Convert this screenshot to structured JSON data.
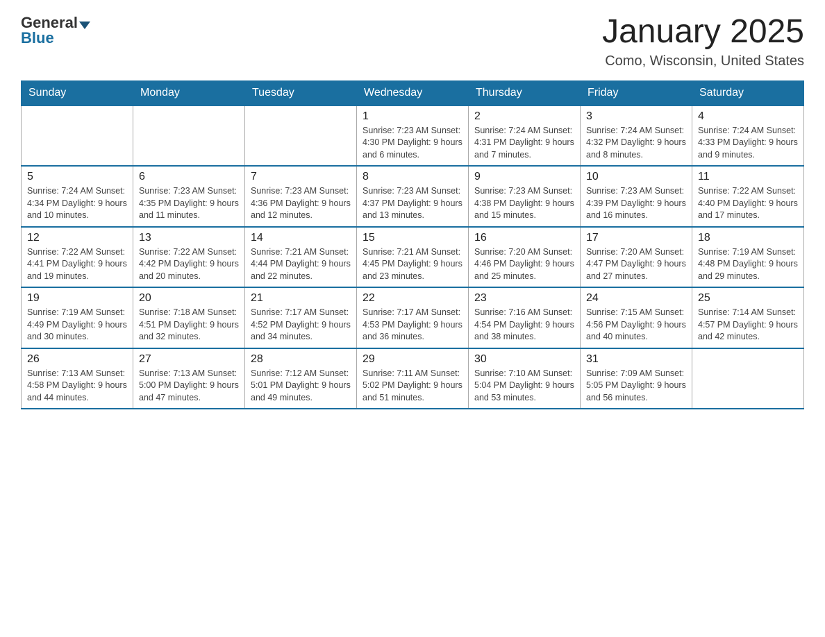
{
  "header": {
    "logo_general": "General",
    "logo_blue": "Blue",
    "title": "January 2025",
    "subtitle": "Como, Wisconsin, United States"
  },
  "calendar": {
    "days_of_week": [
      "Sunday",
      "Monday",
      "Tuesday",
      "Wednesday",
      "Thursday",
      "Friday",
      "Saturday"
    ],
    "weeks": [
      [
        {
          "day": "",
          "info": ""
        },
        {
          "day": "",
          "info": ""
        },
        {
          "day": "",
          "info": ""
        },
        {
          "day": "1",
          "info": "Sunrise: 7:23 AM\nSunset: 4:30 PM\nDaylight: 9 hours and 6 minutes."
        },
        {
          "day": "2",
          "info": "Sunrise: 7:24 AM\nSunset: 4:31 PM\nDaylight: 9 hours and 7 minutes."
        },
        {
          "day": "3",
          "info": "Sunrise: 7:24 AM\nSunset: 4:32 PM\nDaylight: 9 hours and 8 minutes."
        },
        {
          "day": "4",
          "info": "Sunrise: 7:24 AM\nSunset: 4:33 PM\nDaylight: 9 hours and 9 minutes."
        }
      ],
      [
        {
          "day": "5",
          "info": "Sunrise: 7:24 AM\nSunset: 4:34 PM\nDaylight: 9 hours and 10 minutes."
        },
        {
          "day": "6",
          "info": "Sunrise: 7:23 AM\nSunset: 4:35 PM\nDaylight: 9 hours and 11 minutes."
        },
        {
          "day": "7",
          "info": "Sunrise: 7:23 AM\nSunset: 4:36 PM\nDaylight: 9 hours and 12 minutes."
        },
        {
          "day": "8",
          "info": "Sunrise: 7:23 AM\nSunset: 4:37 PM\nDaylight: 9 hours and 13 minutes."
        },
        {
          "day": "9",
          "info": "Sunrise: 7:23 AM\nSunset: 4:38 PM\nDaylight: 9 hours and 15 minutes."
        },
        {
          "day": "10",
          "info": "Sunrise: 7:23 AM\nSunset: 4:39 PM\nDaylight: 9 hours and 16 minutes."
        },
        {
          "day": "11",
          "info": "Sunrise: 7:22 AM\nSunset: 4:40 PM\nDaylight: 9 hours and 17 minutes."
        }
      ],
      [
        {
          "day": "12",
          "info": "Sunrise: 7:22 AM\nSunset: 4:41 PM\nDaylight: 9 hours and 19 minutes."
        },
        {
          "day": "13",
          "info": "Sunrise: 7:22 AM\nSunset: 4:42 PM\nDaylight: 9 hours and 20 minutes."
        },
        {
          "day": "14",
          "info": "Sunrise: 7:21 AM\nSunset: 4:44 PM\nDaylight: 9 hours and 22 minutes."
        },
        {
          "day": "15",
          "info": "Sunrise: 7:21 AM\nSunset: 4:45 PM\nDaylight: 9 hours and 23 minutes."
        },
        {
          "day": "16",
          "info": "Sunrise: 7:20 AM\nSunset: 4:46 PM\nDaylight: 9 hours and 25 minutes."
        },
        {
          "day": "17",
          "info": "Sunrise: 7:20 AM\nSunset: 4:47 PM\nDaylight: 9 hours and 27 minutes."
        },
        {
          "day": "18",
          "info": "Sunrise: 7:19 AM\nSunset: 4:48 PM\nDaylight: 9 hours and 29 minutes."
        }
      ],
      [
        {
          "day": "19",
          "info": "Sunrise: 7:19 AM\nSunset: 4:49 PM\nDaylight: 9 hours and 30 minutes."
        },
        {
          "day": "20",
          "info": "Sunrise: 7:18 AM\nSunset: 4:51 PM\nDaylight: 9 hours and 32 minutes."
        },
        {
          "day": "21",
          "info": "Sunrise: 7:17 AM\nSunset: 4:52 PM\nDaylight: 9 hours and 34 minutes."
        },
        {
          "day": "22",
          "info": "Sunrise: 7:17 AM\nSunset: 4:53 PM\nDaylight: 9 hours and 36 minutes."
        },
        {
          "day": "23",
          "info": "Sunrise: 7:16 AM\nSunset: 4:54 PM\nDaylight: 9 hours and 38 minutes."
        },
        {
          "day": "24",
          "info": "Sunrise: 7:15 AM\nSunset: 4:56 PM\nDaylight: 9 hours and 40 minutes."
        },
        {
          "day": "25",
          "info": "Sunrise: 7:14 AM\nSunset: 4:57 PM\nDaylight: 9 hours and 42 minutes."
        }
      ],
      [
        {
          "day": "26",
          "info": "Sunrise: 7:13 AM\nSunset: 4:58 PM\nDaylight: 9 hours and 44 minutes."
        },
        {
          "day": "27",
          "info": "Sunrise: 7:13 AM\nSunset: 5:00 PM\nDaylight: 9 hours and 47 minutes."
        },
        {
          "day": "28",
          "info": "Sunrise: 7:12 AM\nSunset: 5:01 PM\nDaylight: 9 hours and 49 minutes."
        },
        {
          "day": "29",
          "info": "Sunrise: 7:11 AM\nSunset: 5:02 PM\nDaylight: 9 hours and 51 minutes."
        },
        {
          "day": "30",
          "info": "Sunrise: 7:10 AM\nSunset: 5:04 PM\nDaylight: 9 hours and 53 minutes."
        },
        {
          "day": "31",
          "info": "Sunrise: 7:09 AM\nSunset: 5:05 PM\nDaylight: 9 hours and 56 minutes."
        },
        {
          "day": "",
          "info": ""
        }
      ]
    ]
  }
}
